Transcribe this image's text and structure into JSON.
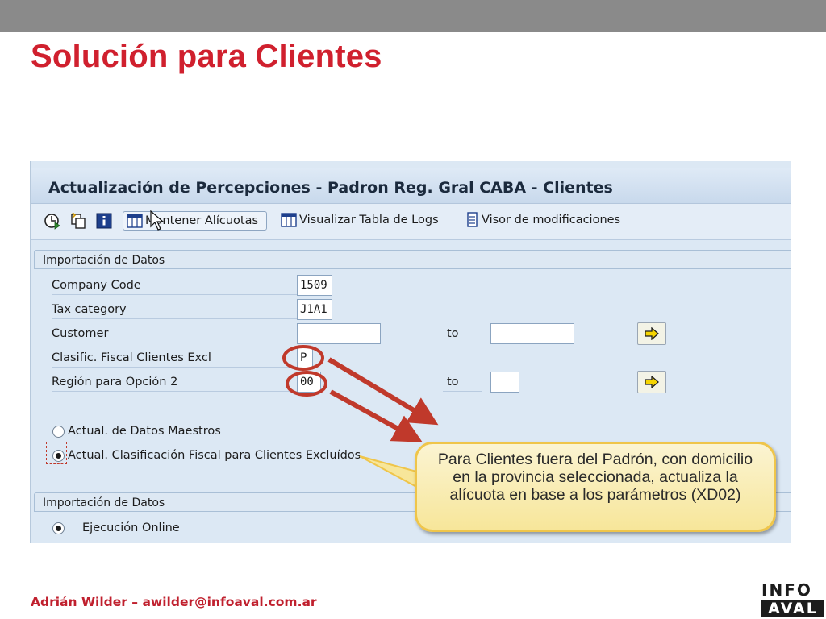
{
  "slide": {
    "title": "Solución para Clientes",
    "footer_author": "Adrián Wilder – awilder@infoaval.com.ar",
    "logo_top": "INFO",
    "logo_bottom": "AVAL"
  },
  "sap": {
    "title": "Actualización de Percepciones - Padron Reg. Gral CABA - Clientes",
    "toolbar": {
      "icons": [
        "execute-clock-icon",
        "copy-variant-icon",
        "info-icon"
      ],
      "buttons": [
        {
          "label": "Mantener Alícuotas",
          "icon": "table-icon"
        },
        {
          "label": "Visualizar Tabla de Logs",
          "icon": "table-icon"
        },
        {
          "label": "Visor de modificaciones",
          "icon": "document-icon"
        }
      ]
    },
    "group1": {
      "title": "Importación de Datos",
      "fields": [
        {
          "label": "Company Code",
          "value": "1509"
        },
        {
          "label": "Tax category",
          "value": "J1A1"
        },
        {
          "label": "Customer",
          "value": "",
          "to_label": "to",
          "to_value": ""
        },
        {
          "label": "Clasific. Fiscal Clientes Excl",
          "value": "P"
        },
        {
          "label": "Región para Opción 2",
          "value": "00",
          "to_label": "to",
          "to_value": ""
        }
      ],
      "radios": [
        {
          "label": "Actual. de Datos Maestros",
          "selected": false
        },
        {
          "label": "Actual. Clasificación Fiscal para Clientes Excluídos",
          "selected": true
        }
      ]
    },
    "group2": {
      "title": "Importación de Datos",
      "radios": [
        {
          "label": "Ejecución Online",
          "selected": true
        }
      ]
    }
  },
  "callout": {
    "text": "Para Clientes fuera del Padrón, con domicilio en la provincia seleccionada, actualiza la alícuota en base a los parámetros (XD02)"
  },
  "colors": {
    "title_red": "#d0202e",
    "annotation_red": "#c0392b",
    "callout_fill": "#f7e69a",
    "sap_background": "#dce8f4"
  }
}
